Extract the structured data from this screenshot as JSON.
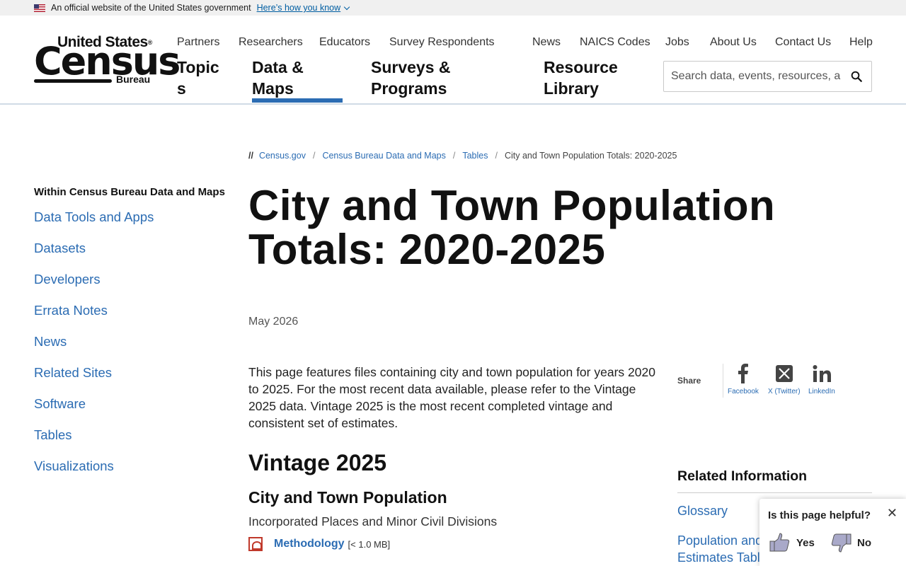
{
  "gov_banner": {
    "text": "An official website of the United States government",
    "link": "Here’s how you know"
  },
  "logo": {
    "top": "United States",
    "reg": "®",
    "main": "Census",
    "bottom": "Bureau"
  },
  "utility_nav": [
    "Partners",
    "Researchers",
    "Educators",
    "Survey Respondents",
    "News",
    "NAICS Codes",
    "Jobs",
    "About Us",
    "Contact Us",
    "Help"
  ],
  "main_nav": {
    "topics_line1": "Topic",
    "topics_line2": "s",
    "data_line1": "Data &",
    "data_line2": "Maps",
    "surveys_line1": "Surveys &",
    "surveys_line2": "Programs",
    "resource_line1": "Resource",
    "resource_line2": "Library"
  },
  "search": {
    "placeholder": "Search data, events, resources, an..."
  },
  "breadcrumb": {
    "lead": "//",
    "items": [
      "Census.gov",
      "Census Bureau Data and Maps",
      "Tables"
    ],
    "current": "City and Town Population Totals: 2020-2025"
  },
  "sidebar": {
    "heading": "Within Census Bureau Data and Maps",
    "items": [
      "Data Tools and Apps",
      "Datasets",
      "Developers",
      "Errata Notes",
      "News",
      "Related Sites",
      "Software",
      "Tables",
      "Visualizations"
    ]
  },
  "main": {
    "title_line1": "City and Town Population",
    "title_line2": "Totals: 2020-2025",
    "date": "May 2026",
    "intro": "This page features files containing city and town population for years 2020 to 2025. For the most recent data available, please refer to the Vintage 2025 data.  Vintage 2025 is the most recent completed vintage and consistent set of estimates.",
    "vintage_heading": "Vintage 2025",
    "city_heading": "City and Town Population",
    "city_sub": "Incorporated Places and Minor Civil Divisions",
    "file_link": "Methodology",
    "file_size": "[< 1.0 MB]"
  },
  "share": {
    "label": "Share",
    "facebook": "Facebook",
    "twitter": "X (Twitter)",
    "linkedin": "LinkedIn"
  },
  "related": {
    "heading": "Related Information",
    "item1": "Glossary",
    "item2_line1": "Population and",
    "item2_line2": "Estimates Tabl"
  },
  "feedback": {
    "question": "Is this page helpful?",
    "close": "✕",
    "yes": "Yes",
    "no": "No"
  },
  "colors": {
    "link": "#2b6cb3",
    "active_tab": "#2b6cb3",
    "banner_link": "#005ea2"
  }
}
